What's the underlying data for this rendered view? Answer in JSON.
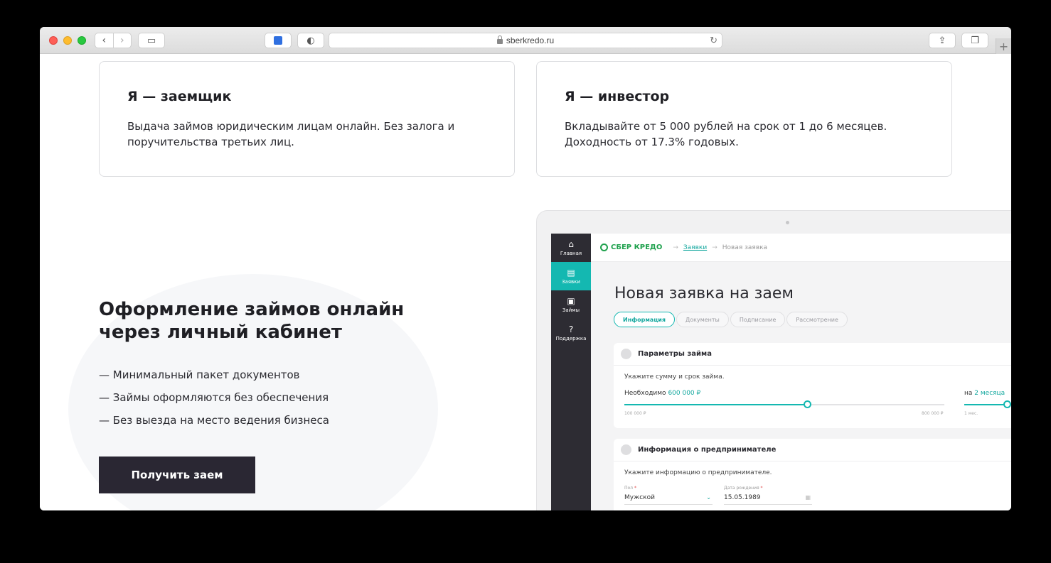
{
  "browser": {
    "url": "sberkredo.ru",
    "icons": {
      "back": "chevron-left-icon",
      "forward": "chevron-right-icon",
      "sidebar": "sidebar-icon",
      "extension": "extension-icon",
      "privacy": "shield-icon",
      "reload": "reload-icon",
      "share": "share-icon",
      "tabs": "tabs-icon",
      "new_tab": "plus-icon"
    }
  },
  "cards": [
    {
      "title": "Я — заемщик",
      "text": "Выдача займов юридическим лицам онлайн. Без залога и поручительства третьих лиц."
    },
    {
      "title": "Я — инвестор",
      "text": "Вкладывайте от 5 000 рублей на срок от 1 до 6 месяцев. Доходность от 17.3% годовых."
    }
  ],
  "feature": {
    "title": "Оформление займов онлайн через личный кабинет",
    "items": [
      "— Минимальный пакет документов",
      "— Займы оформляются без обеспечения",
      "— Без выезда на место ведения бизнеса"
    ],
    "cta": "Получить заем"
  },
  "mockup": {
    "sidebar": [
      {
        "label": "Главная",
        "icon": "home-icon",
        "glyph": "⌂"
      },
      {
        "label": "Заявки",
        "icon": "document-icon",
        "glyph": "▤"
      },
      {
        "label": "Займы",
        "icon": "wallet-icon",
        "glyph": "▣"
      },
      {
        "label": "Поддержка",
        "icon": "help-icon",
        "glyph": "?"
      }
    ],
    "logo": "СБЕР КРЕДО",
    "breadcrumb": {
      "link": "Заявки",
      "current": "Новая заявка"
    },
    "title": "Новая заявка на заем",
    "steps": [
      "Информация",
      "Документы",
      "Подписание",
      "Рассмотрение"
    ],
    "loan_params": {
      "heading": "Параметры займа",
      "hint": "Укажите сумму и срок займа.",
      "amount_label": "Необходимо",
      "amount_value": "600 000 ₽",
      "amount_min": "100 000 ₽",
      "amount_max": "800 000 ₽",
      "amount_fraction": 0.57,
      "term_label": "на",
      "term_value": "2 месяца",
      "term_min": "1 мес."
    },
    "entrepreneur": {
      "heading": "Информация о предпринимателе",
      "hint": "Укажите информацию о предпринимателе.",
      "gender_label": "Пол",
      "gender_value": "Мужской",
      "birth_label": "Дата рождения",
      "birth_value": "15.05.1989",
      "required_mark": "*"
    }
  }
}
